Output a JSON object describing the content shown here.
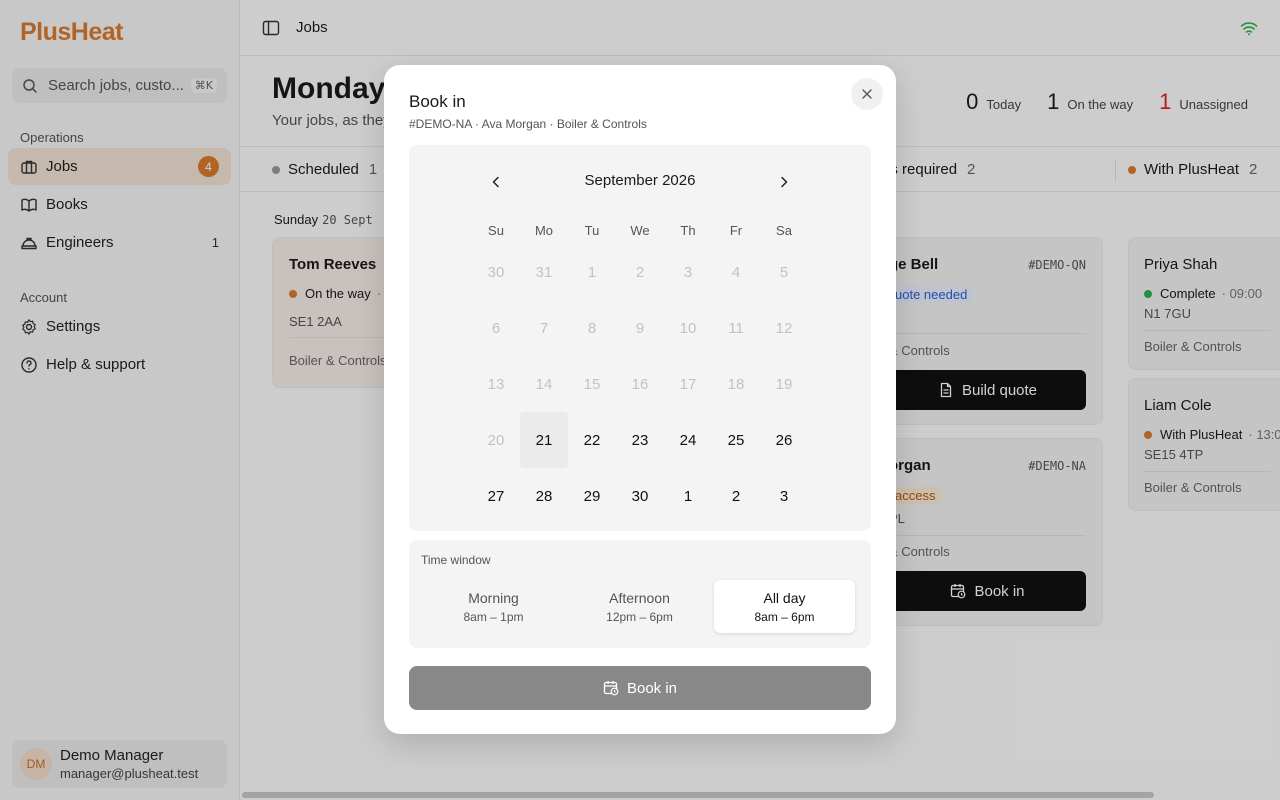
{
  "app": {
    "logo": "PlusHeat"
  },
  "search": {
    "placeholder": "Search jobs, custo...",
    "shortcut": "⌘K"
  },
  "sidebar": {
    "operations_label": "Operations",
    "account_label": "Account",
    "items": [
      {
        "label": "Jobs",
        "badge": "4",
        "icon": "briefcase-icon"
      },
      {
        "label": "Books",
        "icon": "book-icon"
      },
      {
        "label": "Engineers",
        "count": "1",
        "icon": "hard-hat-icon"
      },
      {
        "label": "Settings",
        "icon": "gear-icon"
      },
      {
        "label": "Help & support",
        "icon": "help-circle-icon"
      }
    ],
    "user": {
      "initials": "DM",
      "name": "Demo Manager",
      "email": "manager@plusheat.test"
    }
  },
  "topbar": {
    "title": "Jobs"
  },
  "main": {
    "title": "Monday 2",
    "subtitle": "Your jobs, as they",
    "stats": [
      {
        "value": "0",
        "label": "Today"
      },
      {
        "value": "1",
        "label": "On the way"
      },
      {
        "value": "1",
        "label": "Unassigned"
      }
    ],
    "tabs": [
      {
        "label": "Scheduled",
        "count": "1"
      },
      {
        "label": "ns required",
        "count": "2"
      },
      {
        "label": "With PlusHeat",
        "count": "2"
      }
    ],
    "day": {
      "label": "Sunday",
      "date": "20 Sept"
    }
  },
  "cards": [
    {
      "name": "Tom Reeves",
      "status": "On the way",
      "status_extra": "·",
      "postcode": "SE1 2AA",
      "service": "Boiler & Controls"
    },
    {
      "name": "ge Bell",
      "ref": "#DEMO-QN",
      "status": "uote needed",
      "extra": "o",
      "service": "& Controls",
      "button": "Build quote"
    },
    {
      "name": "organ",
      "ref": "#DEMO-NA",
      "status": "access",
      "postcode": "PL",
      "service": "& Controls",
      "button": "Book in"
    },
    {
      "name": "Priya Shah",
      "status": "Complete",
      "time": "· 09:00",
      "postcode": "N1 7GU",
      "service": "Boiler & Controls"
    },
    {
      "name": "Liam Cole",
      "status": "With PlusHeat",
      "time": "· 13:0",
      "postcode": "SE15 4TP",
      "service": "Boiler & Controls"
    }
  ],
  "modal": {
    "title": "Book in",
    "subtitle": "#DEMO-NA · Ava Morgan · Boiler & Controls",
    "month": "September 2026",
    "weekdays": [
      "Su",
      "Mo",
      "Tu",
      "We",
      "Th",
      "Fr",
      "Sa"
    ],
    "days": [
      [
        "30",
        "31",
        "1",
        "2",
        "3",
        "4",
        "5"
      ],
      [
        "6",
        "7",
        "8",
        "9",
        "10",
        "11",
        "12"
      ],
      [
        "13",
        "14",
        "15",
        "16",
        "17",
        "18",
        "19"
      ],
      [
        "20",
        "21",
        "22",
        "23",
        "24",
        "25",
        "26"
      ],
      [
        "27",
        "28",
        "29",
        "30",
        "1",
        "2",
        "3"
      ]
    ],
    "time_window_label": "Time window",
    "time_options": [
      {
        "name": "Morning",
        "range": "8am – 1pm"
      },
      {
        "name": "Afternoon",
        "range": "12pm – 6pm"
      },
      {
        "name": "All day",
        "range": "8am – 6pm"
      }
    ],
    "selected_time": "All day",
    "book_button": "Book in"
  },
  "colors": {
    "accent": "#d97a2f",
    "danger": "#dd2222",
    "success": "#2bb24c"
  }
}
